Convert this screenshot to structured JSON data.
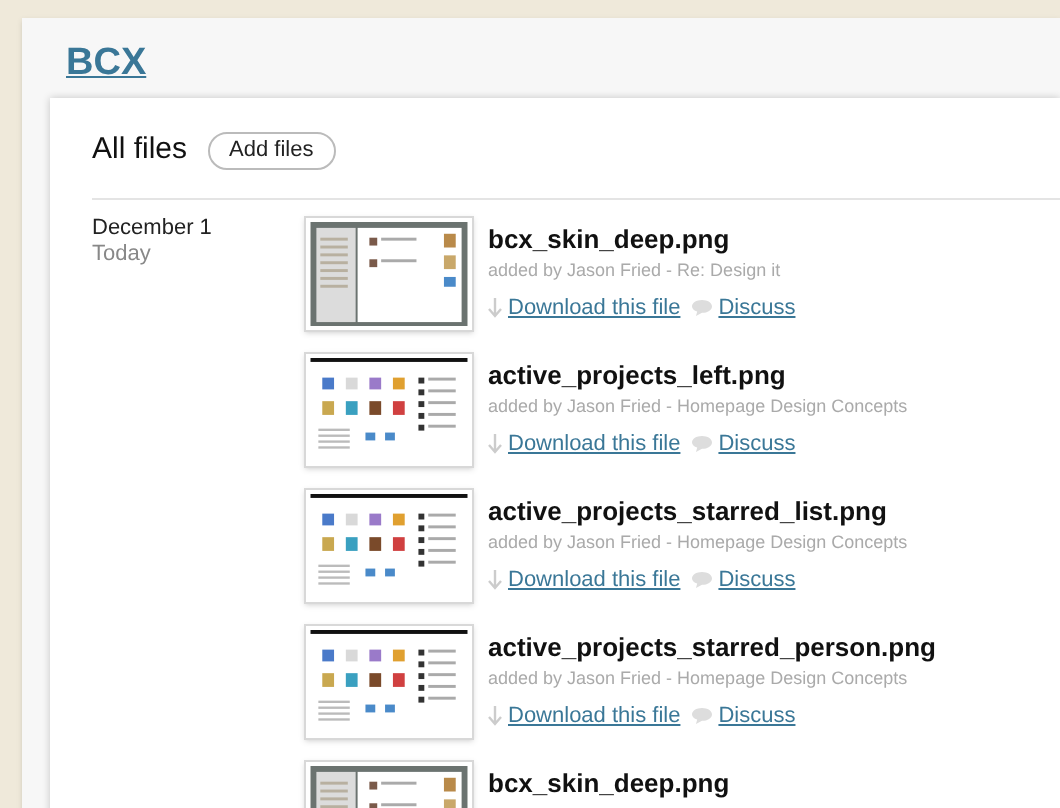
{
  "project": {
    "title": "BCX"
  },
  "header": {
    "title": "All files",
    "button": "Add files"
  },
  "groups": [
    {
      "date": "December 1",
      "relative": "Today",
      "files": [
        {
          "name": "bcx_skin_deep.png",
          "thumbnail": {
            "kind": "sidebar"
          },
          "meta": "added by Jason Fried - Re: Design it",
          "download": "Download this file",
          "discuss": "Discuss"
        },
        {
          "name": "active_projects_left.png",
          "thumbnail": {
            "kind": "grid"
          },
          "meta": "added by Jason Fried - Homepage Design Concepts",
          "download": "Download this file",
          "discuss": "Discuss"
        },
        {
          "name": "active_projects_starred_list.png",
          "thumbnail": {
            "kind": "grid"
          },
          "meta": "added by Jason Fried - Homepage Design Concepts",
          "download": "Download this file",
          "discuss": "Discuss"
        },
        {
          "name": "active_projects_starred_person.png",
          "thumbnail": {
            "kind": "grid"
          },
          "meta": "added by Jason Fried - Homepage Design Concepts",
          "download": "Download this file",
          "discuss": "Discuss"
        },
        {
          "name": "bcx_skin_deep.png",
          "thumbnail": {
            "kind": "sidebar"
          }
        }
      ]
    }
  ]
}
